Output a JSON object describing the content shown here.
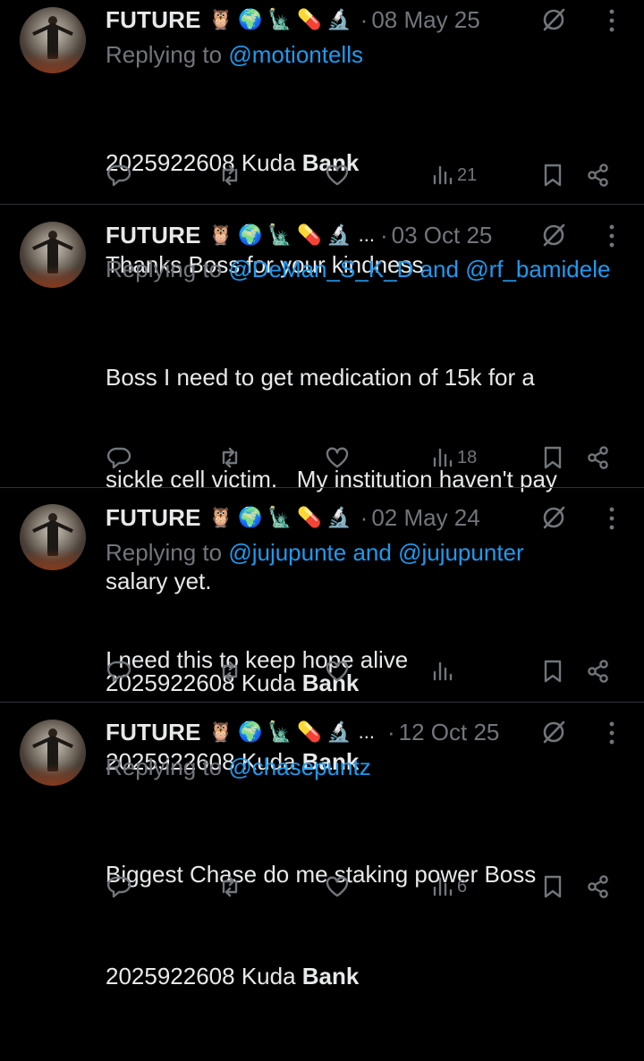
{
  "tweets": [
    {
      "name": "FUTURE",
      "emojis": [
        "🦉",
        "🌍",
        "🗽",
        "💊",
        "🔬"
      ],
      "truncated": false,
      "date": "08 May 25",
      "replying_label": "Replying to",
      "mentions": "@motiontells",
      "body_lines": [
        "2025922608 Kuda ",
        "Thanks Boss for your kindness"
      ],
      "bank_word": "Bank",
      "views": "21"
    },
    {
      "name": "FUTURE",
      "emojis": [
        "🦉",
        "🌍",
        "🗽",
        "💊",
        "🔬"
      ],
      "truncated": true,
      "ellipsis": "...",
      "date": "03 Oct 25",
      "replying_label": "Replying to",
      "mentions": "@DeMan_S_K_D and @rf_bamidele",
      "body_lines": [
        "Boss I need to get medication of 15k for a",
        "sickle cell victim.   My institution haven't pay",
        "salary yet.",
        "2025922608 Kuda "
      ],
      "bank_word": "Bank",
      "views": "18"
    },
    {
      "name": "FUTURE",
      "emojis": [
        "🦉",
        "🌍",
        "🗽",
        "💊",
        "🔬"
      ],
      "truncated": false,
      "date": "02 May 24",
      "replying_label": "Replying to",
      "mentions": "@jujupunte and @jujupunter",
      "body_lines": [
        "I need this to keep hope alive",
        "2025922608 Kuda "
      ],
      "bank_word": "Bank",
      "views": ""
    },
    {
      "name": "FUTURE",
      "emojis": [
        "🦉",
        "🌍",
        "🗽",
        "💊",
        "🔬"
      ],
      "truncated": true,
      "ellipsis": "...",
      "date": "12 Oct 25",
      "replying_label": "Replying to",
      "mentions": "@chasepuntz",
      "body_lines": [
        "Biggest Chase do me staking power Boss",
        "2025922608 Kuda "
      ],
      "bank_word": "Bank",
      "views": "6"
    }
  ],
  "separator": "·",
  "colors": {
    "background": "#000000",
    "text": "#e7e9ea",
    "muted": "#71767b",
    "link": "#1d9bf0",
    "divider": "#2f3336"
  },
  "icons": [
    "reply-icon",
    "retweet-icon",
    "like-icon",
    "views-icon",
    "bookmark-icon",
    "share-icon",
    "grok-icon",
    "more-icon"
  ]
}
